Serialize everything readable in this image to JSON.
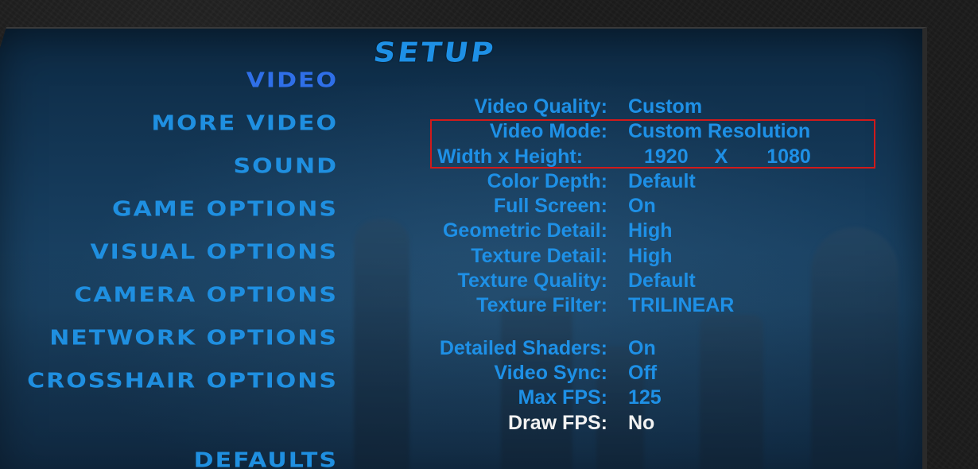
{
  "title": "SETUP",
  "menu": [
    {
      "label": "VIDEO",
      "active": true
    },
    {
      "label": "MORE VIDEO"
    },
    {
      "label": "SOUND"
    },
    {
      "label": "GAME OPTIONS"
    },
    {
      "label": "VISUAL OPTIONS"
    },
    {
      "label": "CAMERA OPTIONS"
    },
    {
      "label": "NETWORK OPTIONS"
    },
    {
      "label": "CROSSHAIR OPTIONS"
    },
    {
      "label": "DEFAULTS"
    }
  ],
  "settings": {
    "video_quality": {
      "label": "Video Quality:",
      "value": "Custom"
    },
    "video_mode": {
      "label": "Video Mode:",
      "value": "Custom Resolution"
    },
    "resolution": {
      "label": "Width x Height:",
      "width": "1920",
      "separator": "X",
      "height": "1080"
    },
    "color_depth": {
      "label": "Color Depth:",
      "value": "Default"
    },
    "full_screen": {
      "label": "Full Screen:",
      "value": "On"
    },
    "geometric_detail": {
      "label": "Geometric Detail:",
      "value": "High"
    },
    "texture_detail": {
      "label": "Texture Detail:",
      "value": "High"
    },
    "texture_quality": {
      "label": "Texture Quality:",
      "value": "Default"
    },
    "texture_filter": {
      "label": "Texture Filter:",
      "value": "TRILINEAR"
    },
    "detailed_shaders": {
      "label": "Detailed Shaders:",
      "value": "On"
    },
    "video_sync": {
      "label": "Video Sync:",
      "value": "Off"
    },
    "max_fps": {
      "label": "Max FPS:",
      "value": "125"
    },
    "draw_fps": {
      "label": "Draw FPS:",
      "value": "No"
    }
  },
  "colors": {
    "menu_text": "#1f8fe0",
    "active_menu": "#2f6fe8",
    "hover_text": "#f2f2f2",
    "highlight_border": "#d11a1a"
  }
}
